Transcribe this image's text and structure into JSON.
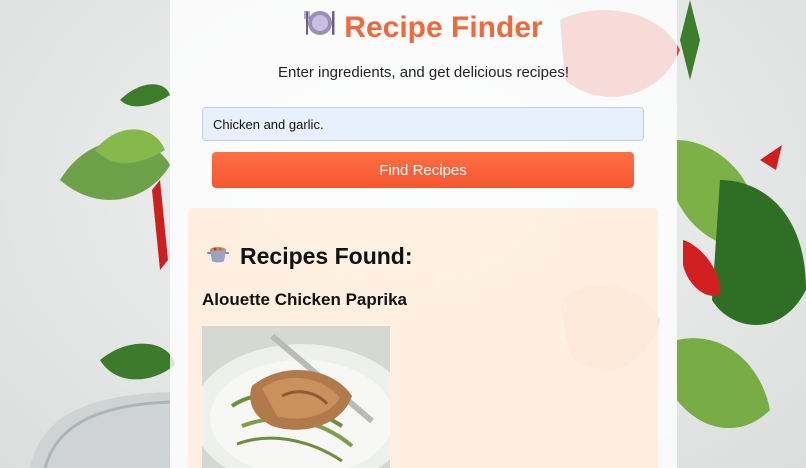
{
  "app": {
    "title": "Recipe Finder",
    "title_icon": "plate-with-utensils-icon",
    "subtitle": "Enter ingredients, and get delicious recipes!"
  },
  "search": {
    "value": "Chicken and garlic.",
    "button_label": "Find Recipes"
  },
  "results": {
    "heading": "Recipes Found:",
    "heading_icon": "stew-pot-icon",
    "recipes": [
      {
        "title": "Alouette Chicken Paprika",
        "image": "chicken-paprika-dish-photo"
      }
    ]
  },
  "colors": {
    "accent": "#ee6a3c",
    "button": "#f6572f",
    "input_bg": "#e8f0fd",
    "results_bg": "#ffecda"
  }
}
